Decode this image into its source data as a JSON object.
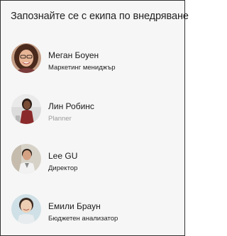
{
  "title": "Запознайте се с екипа по внедряване",
  "members": [
    {
      "name": "Меган Боуен",
      "role": "Маркетинг мениджър",
      "avatar_icon": "person-photo-icon"
    },
    {
      "name": "Лин Робинс",
      "role": "Planner",
      "avatar_icon": "person-photo-icon"
    },
    {
      "name": "Lee GU",
      "role": "Директор",
      "avatar_icon": "person-photo-icon"
    },
    {
      "name": "Емили Браун",
      "role": "Бюджетен анализатор",
      "avatar_icon": "person-photo-icon"
    }
  ],
  "colors": {
    "card_background": "#f6f6f6",
    "border": "#333333",
    "text": "#222222",
    "muted_text": "#9a9a9a"
  }
}
